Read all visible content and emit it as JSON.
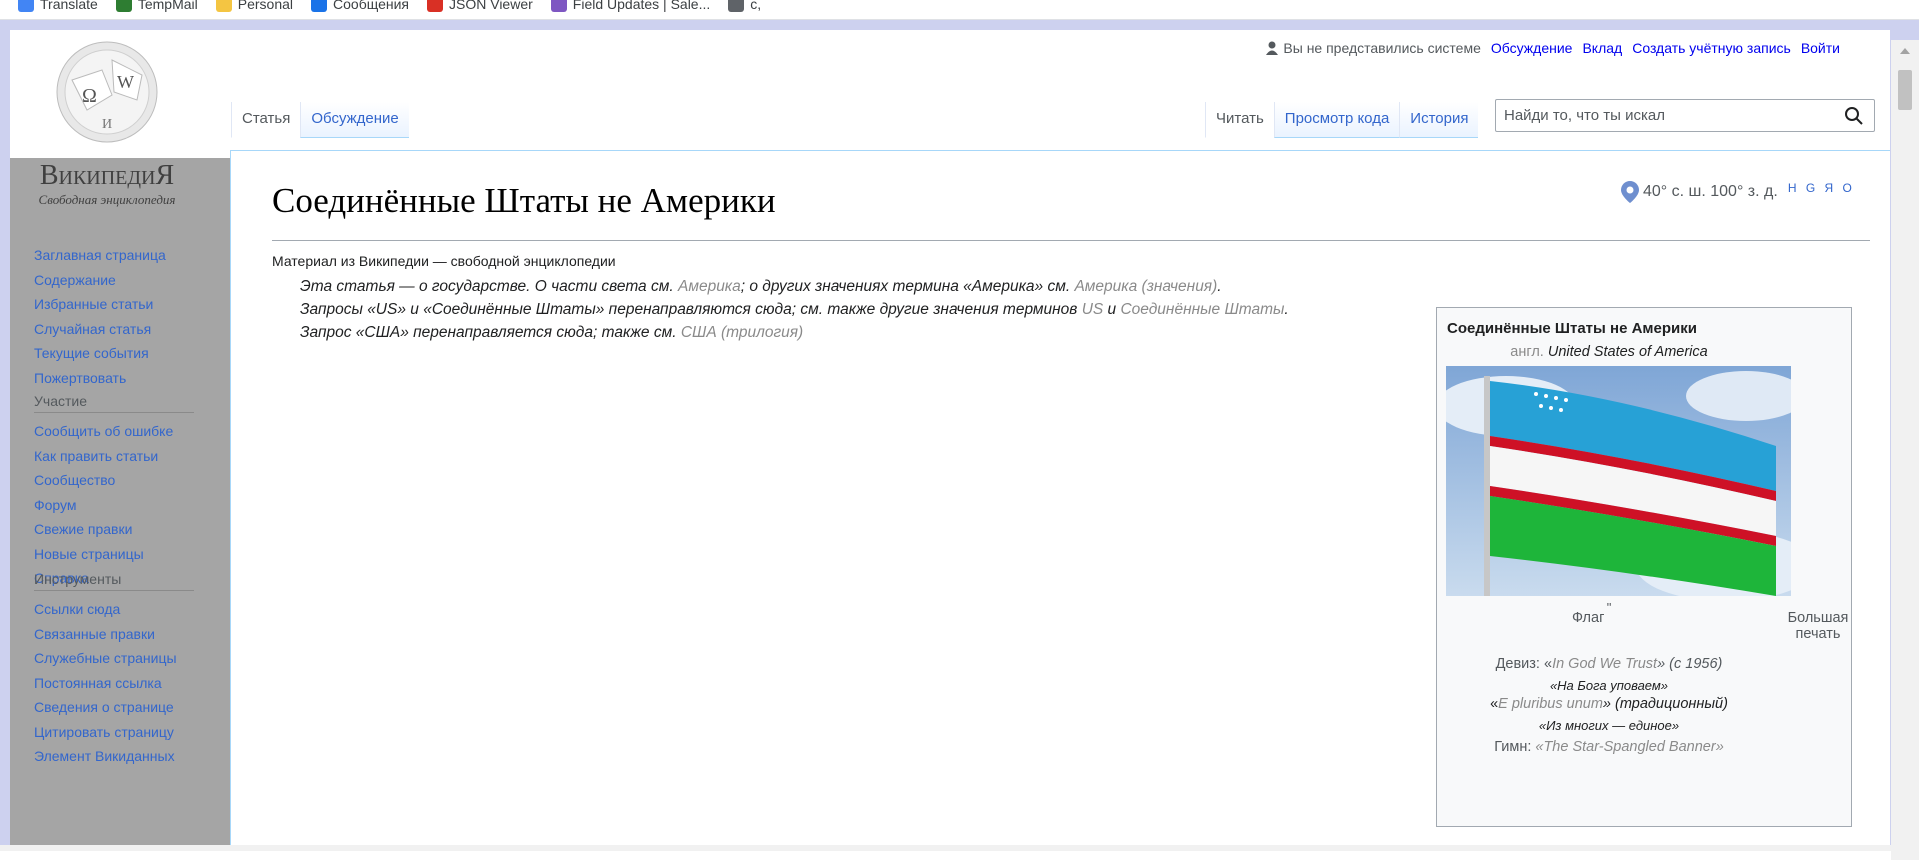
{
  "bookmarks": [
    {
      "label": "Translate",
      "color": "#4285f4"
    },
    {
      "label": "TempMail",
      "color": "#2e7d32"
    },
    {
      "label": "Personal",
      "color": "#f4c542"
    },
    {
      "label": "Сообщения",
      "color": "#1a73e8"
    },
    {
      "label": "JSON Viewer",
      "color": "#d93025"
    },
    {
      "label": "Field Updates | Sale...",
      "color": "#7e57c2"
    },
    {
      "label": "c,",
      "color": "#5f6368"
    }
  ],
  "logo": {
    "name": "ВикипедиЯ",
    "tagline": "Свободная энциклопедия"
  },
  "personal": {
    "anon": "Вы не представились системе",
    "links": [
      "Обсуждение",
      "Вклад",
      "Создать учётную запись",
      "Войти"
    ]
  },
  "tabs_left": [
    "Статья",
    "Обсуждение"
  ],
  "tabs_right": [
    "Читать",
    "Просмотр кода",
    "История"
  ],
  "search": {
    "placeholder": "Найди то, что ты искал"
  },
  "nav": {
    "main": [
      "Заглавная страница",
      "Содержание",
      "Избранные статьи",
      "Случайная статья",
      "Текущие события",
      "Пожертвовать"
    ],
    "participation_heading": "Участие",
    "participation": [
      "Сообщить об ошибке",
      "Как править статьи",
      "Сообщество",
      "Форум",
      "Свежие правки",
      "Новые страницы",
      "Справка"
    ],
    "tools_heading": "Инструменты",
    "tools": [
      "Ссылки сюда",
      "Связанные правки",
      "Служебные страницы",
      "Постоянная ссылка",
      "Сведения о странице",
      "Цитировать страницу",
      "Элемент Викиданных"
    ]
  },
  "article": {
    "title": "Соединённые Штаты не Америки",
    "coords": "40° с. ш. 100° з. д.",
    "coords_links": "H G Я O",
    "tagline": "Материал из Википедии — свободной энциклопедии",
    "hatnote1_a": "Эта статья — о государстве. О части света см. ",
    "hatnote1_b": "Америка",
    "hatnote1_c": "; о других значениях термина «Америка» см. ",
    "hatnote1_d": "Америка (значения)",
    "hatnote2_a": "Запросы «US» и «Соединённые Штаты» перенаправляются сюда; см. также другие значения терминов ",
    "hatnote2_b": "US",
    "hatnote2_c": " и ",
    "hatnote2_d": "Соединённые Штаты",
    "hatnote3_a": "Запрос «США» перенаправляется сюда; также см. ",
    "hatnote3_b": "США (трилогия)"
  },
  "infobox": {
    "title": "Соединённые Штаты не Америки",
    "subtitle_lang": "англ.",
    "subtitle": "United States of America",
    "quote_mark": "\"",
    "flag_caption": "Флаг",
    "seal_caption": "Большая печать",
    "motto1_label": "Девиз: «",
    "motto1": "In God We Trust",
    "motto1_year": "» (с 1956)",
    "motto1_tr": "«На Бога уповаем»",
    "motto2": "E pluribus unum",
    "motto2_note": "» (традиционный)",
    "motto2_tr": "«Из многих — единое»",
    "anthem_label": "Гимн: ",
    "anthem": "«The Star-Spangled Banner»",
    "flag_colors": [
      "#27a1d6",
      "#ffffff",
      "#ce1126",
      "#1eb53a"
    ]
  }
}
